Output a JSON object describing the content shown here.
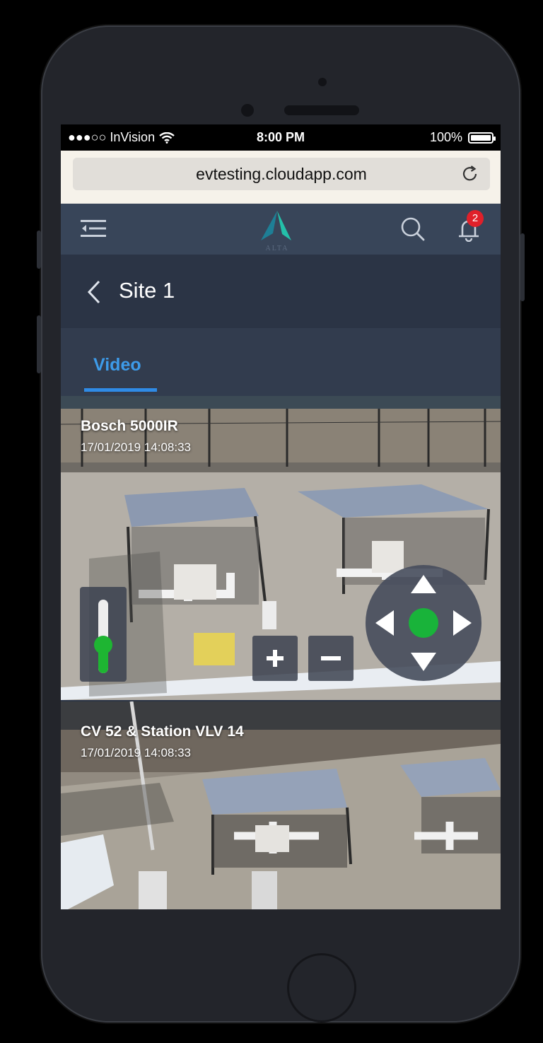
{
  "status_bar": {
    "carrier": "●●●○○ InVision",
    "time": "8:00 PM",
    "battery": "100%"
  },
  "browser": {
    "url": "evtesting.cloudapp.com"
  },
  "app_bar": {
    "notification_count": "2",
    "logo_text": "ALTA"
  },
  "header": {
    "title": "Site 1"
  },
  "tabs": [
    {
      "label": "Video",
      "active": true
    }
  ],
  "feeds": [
    {
      "name": "Bosch 5000IR",
      "timestamp": "17/01/2019 14:08:33",
      "zoom_level": 0.35
    },
    {
      "name": "CV 52 & Station VLV 14",
      "timestamp": "17/01/2019 14:08:33"
    }
  ],
  "colors": {
    "accent": "#2f8be6",
    "control_green": "#1eb532",
    "badge_red": "#e0202a",
    "app_bar": "#384559"
  },
  "icons": {
    "menu": "menu-collapse-icon",
    "search": "search-icon",
    "notifications": "bell-icon",
    "back": "chevron-left-icon",
    "reload": "reload-icon"
  }
}
